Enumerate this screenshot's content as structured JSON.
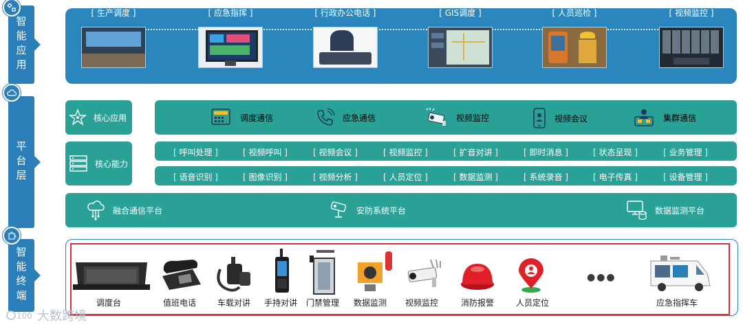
{
  "layers": {
    "app": "智能应用",
    "platform": "平台层",
    "terminal": "智能终端"
  },
  "apps": [
    "[ 生产调度 ]",
    "[ 应急指挥 ]",
    "[ 行政办公电话 ]",
    "[ GIS调度 ]",
    "[ 人员巡检 ]",
    "[ 视频监控 ]"
  ],
  "core_apps": {
    "title": "核心应用",
    "items": [
      "调度通信",
      "应急通信",
      "视频监控",
      "视频会议",
      "集群通信"
    ]
  },
  "core_capability": {
    "title": "核心能力",
    "row1": [
      "[ 呼叫处理 ]",
      "[ 视频呼叫 ]",
      "[ 视频会议 ]",
      "[ 视频监控 ]",
      "[ 扩音对讲 ]",
      "[ 即时消息 ]",
      "[ 状态呈现 ]",
      "[ 业务管理 ]"
    ],
    "row2": [
      "[ 语音识别 ]",
      "[ 图像识别 ]",
      "[ 视频分析 ]",
      "[ 人员定位 ]",
      "[ 数据监测 ]",
      "[ 系统录音 ]",
      "[ 电子传真 ]",
      "[ 设备管理 ]"
    ]
  },
  "platforms": [
    "融合通信平台",
    "安防系统平台",
    "数据监测平台"
  ],
  "devices": [
    "调度台",
    "值班电话",
    "车载对讲",
    "手持对讲",
    "门禁管理",
    "数据监测",
    "视频监控",
    "消防报警",
    "人员定位",
    "应急指挥车"
  ],
  "ellipsis": "●●●",
  "watermark": "大数跨境",
  "colors": {
    "blue": "#2a7fb8",
    "teal": "#2aa197",
    "red": "#d9303c"
  }
}
